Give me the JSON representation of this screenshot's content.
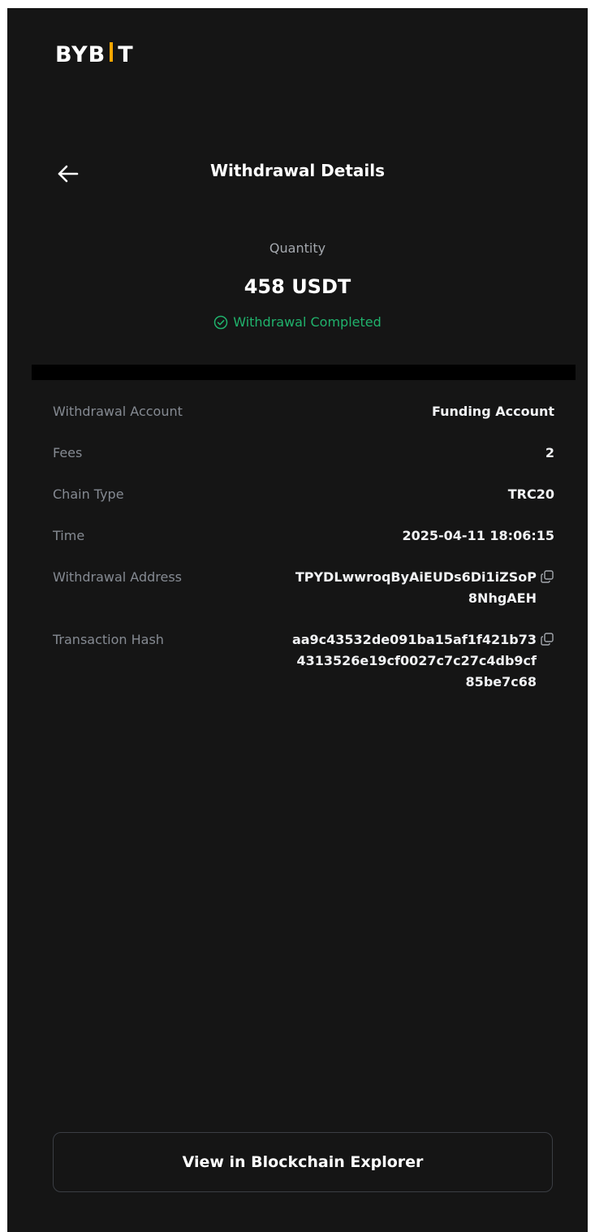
{
  "brand": {
    "logo_left": "BYB",
    "logo_right": "T",
    "accent_color": "#f7a600"
  },
  "header": {
    "back_icon": "arrow-left-icon",
    "title": "Withdrawal Details"
  },
  "summary": {
    "quantity_label": "Quantity",
    "quantity_value": "458 USDT",
    "status_icon": "check-circle-icon",
    "status_text": "Withdrawal Completed",
    "status_color": "#20b26c"
  },
  "details": {
    "rows": [
      {
        "label": "Withdrawal Account",
        "value": "Funding Account"
      },
      {
        "label": "Fees",
        "value": "2"
      },
      {
        "label": "Chain Type",
        "value": "TRC20"
      },
      {
        "label": "Time",
        "value": "2025-04-11 18:06:15"
      }
    ],
    "address": {
      "label": "Withdrawal Address",
      "lines": [
        "TPYDLwwroqByAiEUDs6Di1iZSoP",
        "8NhgAEH"
      ],
      "copy_icon": "copy-icon"
    },
    "hash": {
      "label": "Transaction Hash",
      "lines": [
        "aa9c43532de091ba15af1f421b73",
        "4313526e19cf0027c7c27c4db9cf",
        "85be7c68"
      ],
      "copy_icon": "copy-icon"
    }
  },
  "footer": {
    "explorer_button": "View in Blockchain Explorer"
  }
}
